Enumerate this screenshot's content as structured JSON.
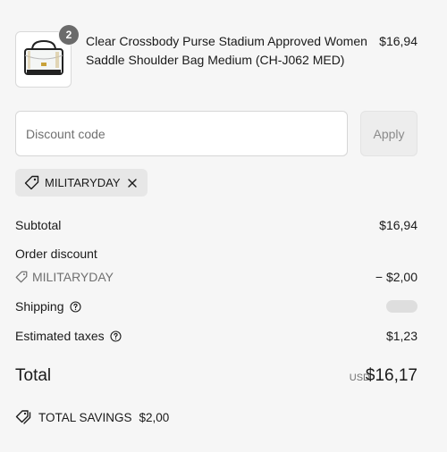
{
  "line_item": {
    "quantity": "2",
    "title": "Clear Crossbody Purse Stadium Approved Women Saddle Shoulder Bag Medium (CH-J062 MED)",
    "price": "$16,94",
    "image_icon": "clear-crossbody-bag-image"
  },
  "discount": {
    "placeholder": "Discount code",
    "apply_label": "Apply",
    "applied_code": "MILITARYDAY"
  },
  "summary": {
    "subtotal_label": "Subtotal",
    "subtotal_value": "$16,94",
    "order_discount_label": "Order discount",
    "discount_code": "MILITARYDAY",
    "discount_value": "− $2,00",
    "shipping_label": "Shipping",
    "taxes_label": "Estimated taxes",
    "taxes_value": "$1,23"
  },
  "total": {
    "label": "Total",
    "currency": "USD",
    "value": "$16,17"
  },
  "savings": {
    "label": "TOTAL SAVINGS",
    "value": "$2,00"
  },
  "colors": {
    "background": "#f6f6f6",
    "text": "#1a1a1a",
    "muted": "#707070",
    "badge": "#6b6b6b",
    "chip": "#e7e7e7"
  }
}
